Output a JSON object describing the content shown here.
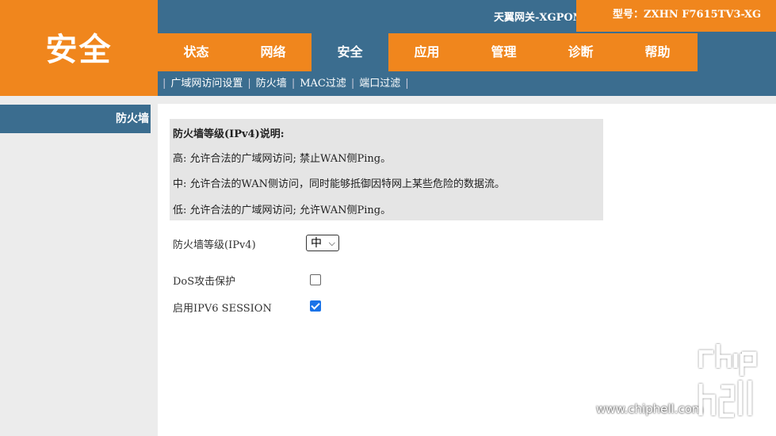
{
  "header": {
    "section_title": "安全",
    "device_name": "天翼网关-XGPON",
    "model_label": "型号：ZXHN F7615TV3-XG"
  },
  "tabs": [
    {
      "label": "状态",
      "active": false
    },
    {
      "label": "网络",
      "active": false
    },
    {
      "label": "安全",
      "active": true
    },
    {
      "label": "应用",
      "active": false
    },
    {
      "label": "管理",
      "active": false
    },
    {
      "label": "诊断",
      "active": false
    },
    {
      "label": "帮助",
      "active": false
    }
  ],
  "subnav": [
    "广域网访问设置",
    "防火墙",
    "MAC过滤",
    "端口过滤"
  ],
  "sidebar": {
    "items": [
      {
        "label": "防火墙"
      }
    ]
  },
  "info": {
    "heading": "防火墙等级(IPv4)说明:",
    "lines": [
      "高:  允许合法的广域网访问; 禁止WAN侧Ping。",
      "中:  允许合法的WAN侧访问，同时能够抵御因特网上某些危险的数据流。",
      "低:  允许合法的广域网访问; 允许WAN侧Ping。"
    ]
  },
  "form": {
    "level_label": "防火墙等级(IPv4)",
    "level_value": "中",
    "dos_label": "DoS攻击保护",
    "dos_checked": false,
    "ipv6_label": "启用IPV6 SESSION",
    "ipv6_checked": true
  },
  "watermark": {
    "site": "www.chiphell.com",
    "logo_text": "chip hell"
  },
  "colors": {
    "orange": "#f0861d",
    "blue": "#3b6d8f",
    "panel": "#e5e5e5"
  }
}
